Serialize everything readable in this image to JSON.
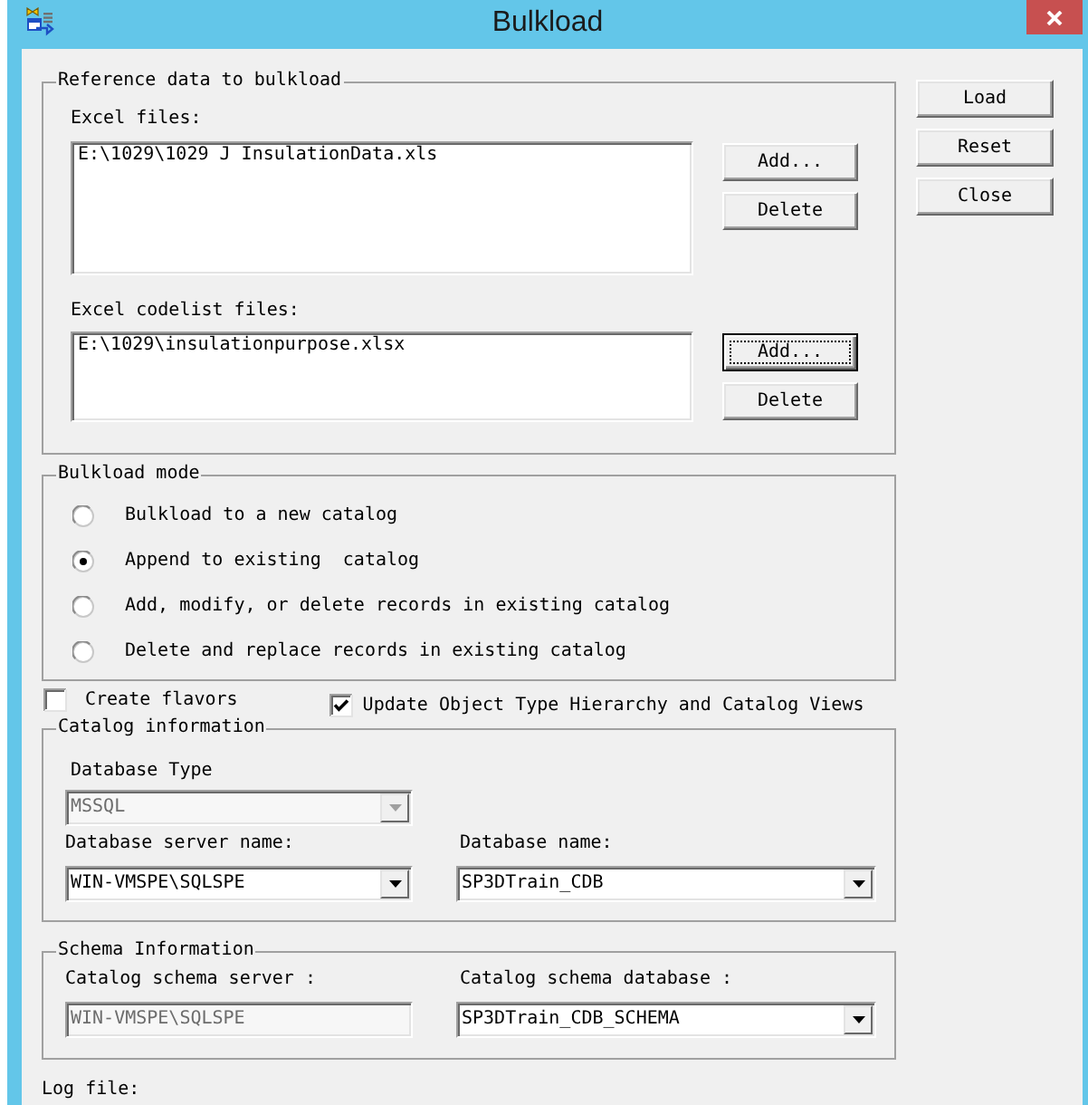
{
  "window": {
    "title": "Bulkload"
  },
  "reference_group": {
    "legend": "Reference data to bulkload",
    "sections": [
      {
        "label": "Excel files:",
        "files": [
          "E:\\1029\\1029 J InsulationData.xls"
        ],
        "buttons": [
          {
            "label": "Add...",
            "focused": false
          },
          {
            "label": "Delete",
            "focused": false
          }
        ]
      },
      {
        "label": "Excel codelist files:",
        "files": [
          "E:\\1029\\insulationpurpose.xlsx"
        ],
        "buttons": [
          {
            "label": "Add...",
            "focused": true
          },
          {
            "label": "Delete",
            "focused": false
          }
        ]
      }
    ]
  },
  "actions": [
    {
      "label": "Load"
    },
    {
      "label": "Reset"
    },
    {
      "label": "Close"
    }
  ],
  "mode_group": {
    "legend": "Bulkload mode",
    "options": [
      {
        "label": "Bulkload to a new catalog",
        "selected": false
      },
      {
        "label": "Append to existing  catalog",
        "selected": true
      },
      {
        "label": "Add, modify, or delete records in existing catalog",
        "selected": false
      },
      {
        "label": "Delete and replace records in existing catalog",
        "selected": false
      }
    ]
  },
  "checkboxes": [
    {
      "label": "Create flavors",
      "checked": false
    },
    {
      "label": "Update Object Type Hierarchy and Catalog Views",
      "checked": true
    }
  ],
  "catalog_group": {
    "legend": "Catalog information",
    "database_type": {
      "label": "Database Type",
      "value": "MSSQL",
      "kind": "combo",
      "disabled": true
    },
    "server": {
      "label": "Database server name:",
      "value": "WIN-VMSPE\\SQLSPE",
      "kind": "combo",
      "disabled": false
    },
    "database": {
      "label": "Database name:",
      "value": "SP3DTrain_CDB",
      "kind": "combo",
      "disabled": false
    }
  },
  "schema_group": {
    "legend": "Schema Information",
    "server": {
      "label": "Catalog schema server :",
      "value": "WIN-VMSPE\\SQLSPE",
      "kind": "text",
      "disabled": true
    },
    "database": {
      "label": "Catalog schema database :",
      "value": "SP3DTrain_CDB_SCHEMA",
      "kind": "combo",
      "disabled": false
    }
  },
  "log_file": {
    "label": "Log file:"
  }
}
